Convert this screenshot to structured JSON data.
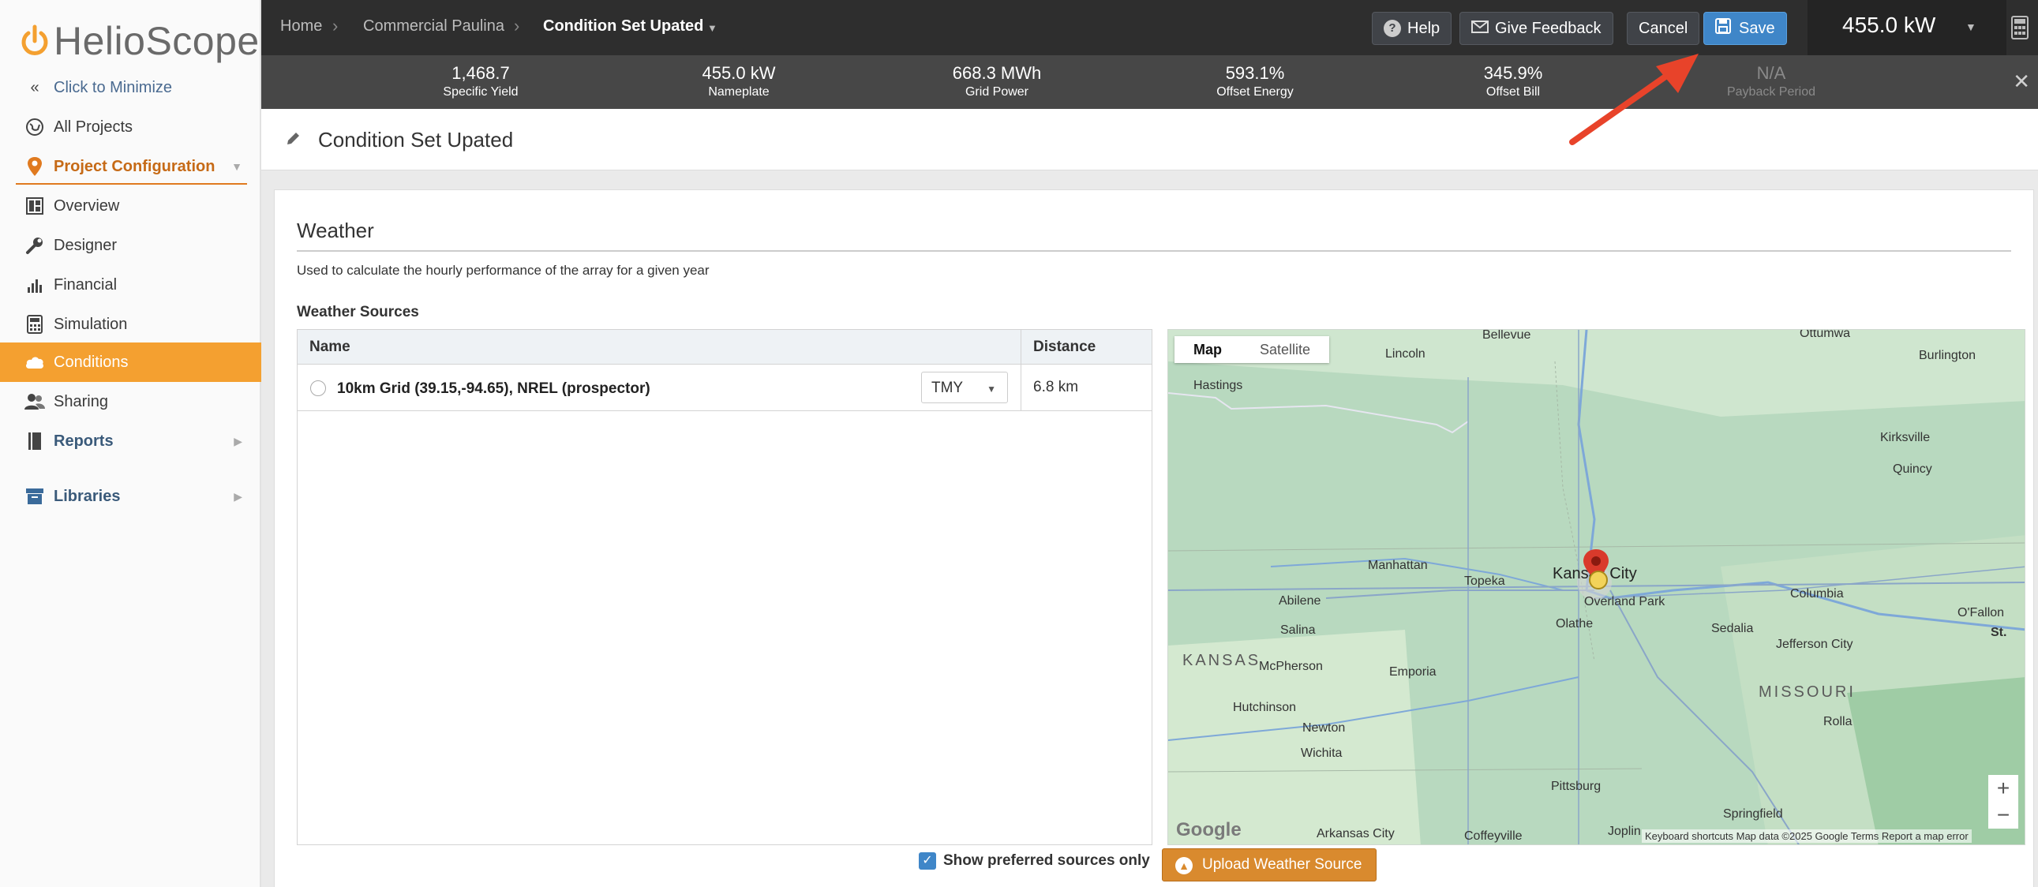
{
  "app": {
    "name": "HelioScope",
    "brand_color": "#f4a030",
    "accent_color": "#3f86c8"
  },
  "sidebar": {
    "minimize_label": "Click to Minimize",
    "items": [
      {
        "label": "All Projects",
        "icon": "globe-icon"
      },
      {
        "label": "Project Configuration",
        "icon": "map-pin-icon"
      },
      {
        "label": "Overview",
        "icon": "dashboard-icon"
      },
      {
        "label": "Designer",
        "icon": "wrench-icon"
      },
      {
        "label": "Financial",
        "icon": "bar-chart-icon"
      },
      {
        "label": "Simulation",
        "icon": "calculator-icon"
      },
      {
        "label": "Conditions",
        "icon": "cloud-icon",
        "active": true
      },
      {
        "label": "Sharing",
        "icon": "users-icon"
      },
      {
        "label": "Reports",
        "icon": "book-icon"
      },
      {
        "label": "Libraries",
        "icon": "archive-icon"
      }
    ]
  },
  "topbar": {
    "breadcrumbs": [
      "Home",
      "Commercial Paulina",
      "Condition Set Upated"
    ],
    "help_label": "Help",
    "feedback_label": "Give Feedback",
    "cancel_label": "Cancel",
    "save_label": "Save",
    "power": "455.0 kW"
  },
  "stats": [
    {
      "value": "1,468.7",
      "label": "Specific Yield"
    },
    {
      "value": "455.0 kW",
      "label": "Nameplate"
    },
    {
      "value": "668.3 MWh",
      "label": "Grid Power"
    },
    {
      "value": "593.1%",
      "label": "Offset Energy"
    },
    {
      "value": "345.9%",
      "label": "Offset Bill"
    },
    {
      "value": "N/A",
      "label": "Payback Period"
    }
  ],
  "page": {
    "title": "Condition Set Upated"
  },
  "weather": {
    "heading": "Weather",
    "description": "Used to calculate the hourly performance of the array for a given year",
    "sources_label": "Weather Sources",
    "columns": [
      "Name",
      "Distance"
    ],
    "rows": [
      {
        "name": "10km Grid (39.15,-94.65), NREL (prospector)",
        "type": "TMY",
        "distance": "6.8 km"
      }
    ],
    "show_preferred_label": "Show preferred sources only",
    "upload_label": "Upload Weather Source"
  },
  "map": {
    "tabs": [
      "Map",
      "Satellite"
    ],
    "cities": [
      {
        "name": "Lincoln"
      },
      {
        "name": "Hastings"
      },
      {
        "name": "Kirksville"
      },
      {
        "name": "Burlington"
      },
      {
        "name": "Quincy"
      },
      {
        "name": "Manhattan"
      },
      {
        "name": "Topeka"
      },
      {
        "name": "Kansas City"
      },
      {
        "name": "Overland Park"
      },
      {
        "name": "Columbia"
      },
      {
        "name": "Abilene"
      },
      {
        "name": "Salina"
      },
      {
        "name": "Olathe"
      },
      {
        "name": "Sedalia"
      },
      {
        "name": "Jefferson City"
      },
      {
        "name": "McPherson"
      },
      {
        "name": "Emporia"
      },
      {
        "name": "Hutchinson"
      },
      {
        "name": "Newton"
      },
      {
        "name": "Wichita"
      },
      {
        "name": "Rolla"
      },
      {
        "name": "Pittsburg"
      },
      {
        "name": "Springfield"
      },
      {
        "name": "Arkansas City"
      },
      {
        "name": "Coffeyville"
      },
      {
        "name": "Joplin"
      },
      {
        "name": "O'Fallon"
      },
      {
        "name": "St."
      },
      {
        "name": "Bellevue"
      },
      {
        "name": "Ottumwa"
      }
    ],
    "states": [
      "KANSAS",
      "MISSOURI"
    ],
    "footer": "Keyboard shortcuts     Map data ©2025 Google     Terms     Report a map error",
    "google": "Google"
  }
}
